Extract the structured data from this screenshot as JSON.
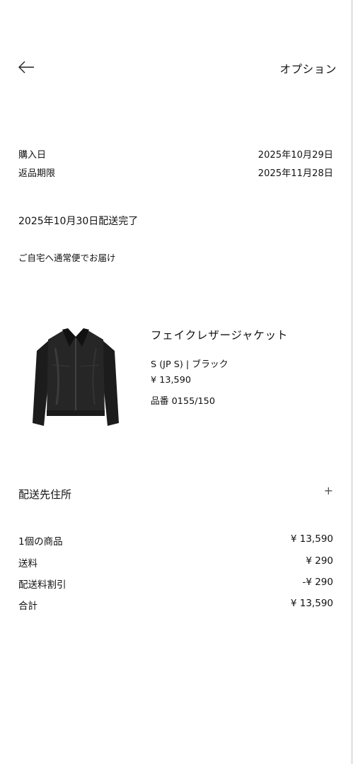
{
  "header": {
    "back_icon": "arrow-left-icon",
    "options_label": "オプション"
  },
  "order": {
    "purchase_date_label": "購入日",
    "purchase_date_value": "2025年10月29日",
    "return_deadline_label": "返品期限",
    "return_deadline_value": "2025年11月28日",
    "delivery_status": "2025年10月30日配送完了",
    "delivery_method": "ご自宅へ通常便でお届け"
  },
  "item": {
    "image_icon": "leather-jacket-image",
    "name": "フェイクレザージャケット",
    "size_color": "S (JP S) | ブラック",
    "price": "¥ 13,590",
    "product_code": "品番 0155/150"
  },
  "shipping_address": {
    "label": "配送先住所",
    "expand_icon": "plus-icon",
    "expand_glyph": "+"
  },
  "summary": {
    "rows": [
      {
        "label": "1個の商品",
        "value": "¥ 13,590"
      },
      {
        "label": "送料",
        "value": "¥ 290"
      },
      {
        "label": "配送料割引",
        "value": "-¥ 290"
      },
      {
        "label": "合計",
        "value": "¥ 13,590"
      }
    ]
  }
}
